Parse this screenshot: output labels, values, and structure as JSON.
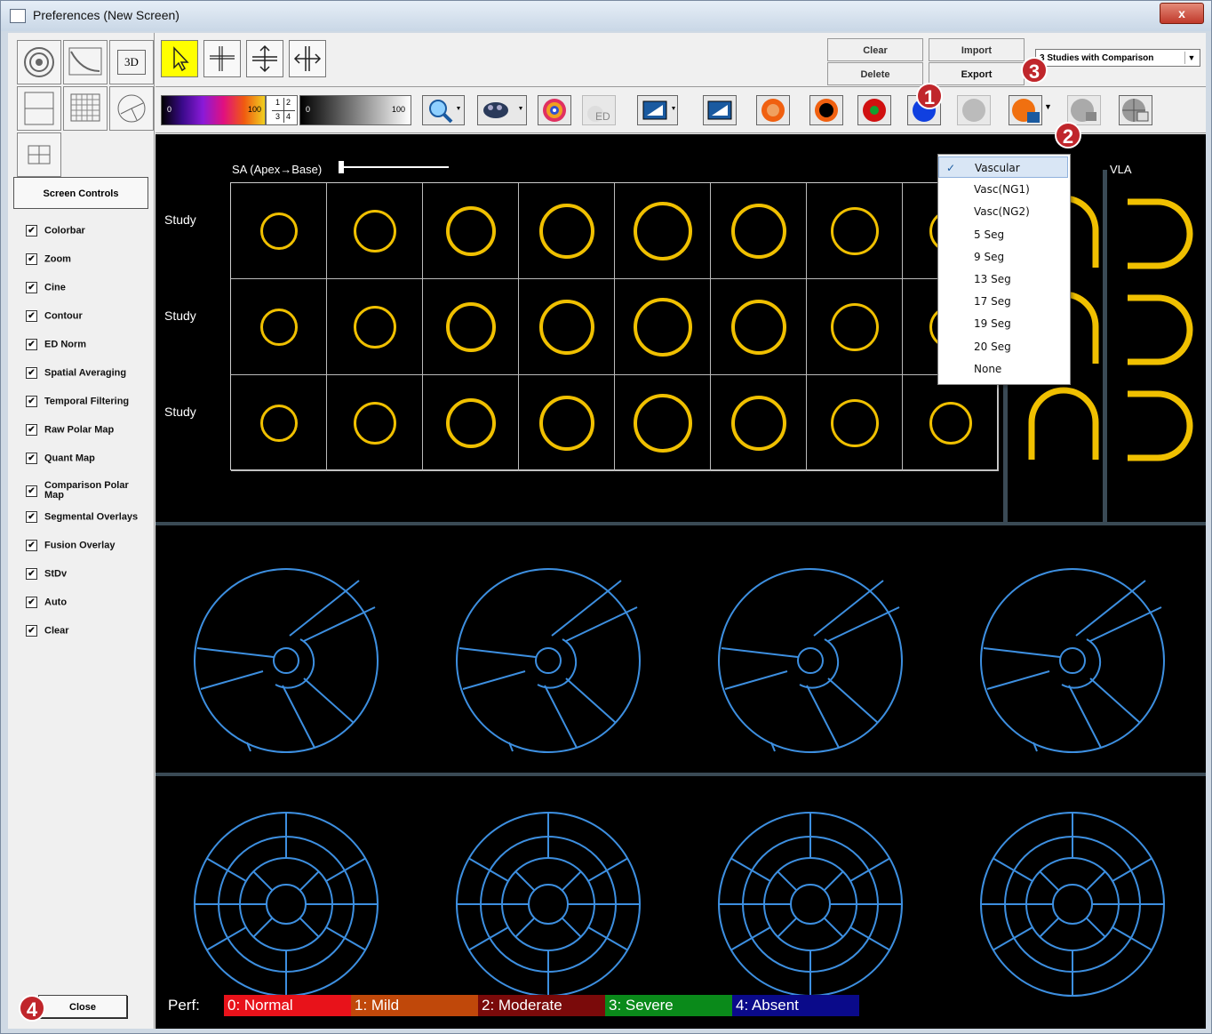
{
  "window": {
    "title": "Preferences (New Screen)",
    "close_glyph": "x"
  },
  "left_panel": {
    "layout_buttons": [
      "polar-map-layout",
      "curve-layout",
      "3d-layout",
      "split-layout",
      "grid-layout",
      "pie-layout",
      "tile-layout"
    ],
    "layout_3d_label": "3D",
    "screen_controls_label": "Screen Controls",
    "checkboxes": [
      {
        "label": "Colorbar",
        "checked": true
      },
      {
        "label": "Zoom",
        "checked": true
      },
      {
        "label": "Cine",
        "checked": true
      },
      {
        "label": "Contour",
        "checked": true
      },
      {
        "label": "ED Norm",
        "checked": true
      },
      {
        "label": "Spatial Averaging",
        "checked": true
      },
      {
        "label": "Temporal Filtering",
        "checked": true
      },
      {
        "label": "Raw Polar Map",
        "checked": true
      },
      {
        "label": "Quant Map",
        "checked": true
      },
      {
        "label": "Comparison Polar Map",
        "checked": true
      },
      {
        "label": "Segmental Overlays",
        "checked": true
      },
      {
        "label": "Fusion Overlay",
        "checked": true
      },
      {
        "label": "StDv",
        "checked": true
      },
      {
        "label": "Auto",
        "checked": true
      },
      {
        "label": "Clear",
        "checked": true
      }
    ],
    "close_label": "Close",
    "check_glyph": "✔"
  },
  "toolbar": {
    "clear_label": "Clear",
    "delete_label": "Delete",
    "import_label": "Import",
    "export_label": "Export",
    "study_select": "3 Studies with Comparison",
    "colorbar1": {
      "min": "0",
      "max": "100"
    },
    "colorbar2": {
      "min": "0",
      "max": "100"
    },
    "quad": [
      "1",
      "2",
      "3",
      "4"
    ],
    "ed_label": "ED"
  },
  "display": {
    "sa_label": "SA (Apex→Base)",
    "vla_label": "VLA",
    "row_labels": [
      "Study",
      "Study",
      "Study"
    ],
    "contour_color": "#f0c000",
    "polar_color": "#3d8fe0"
  },
  "dropdown": {
    "items": [
      "Vascular",
      "Vasc(NG1)",
      "Vasc(NG2)",
      "5 Seg",
      "9 Seg",
      "13 Seg",
      "17 Seg",
      "19 Seg",
      "20 Seg",
      "None"
    ],
    "selected": "Vascular",
    "check_glyph": "✓"
  },
  "perf_legend": {
    "label": "Perf:",
    "items": [
      {
        "label": "0: Normal",
        "color": "#e8121a"
      },
      {
        "label": "1: Mild",
        "color": "#c0480a"
      },
      {
        "label": "2: Moderate",
        "color": "#7a0a0a"
      },
      {
        "label": "3: Severe",
        "color": "#0a8a1a"
      },
      {
        "label": "4: Absent",
        "color": "#0a0a8a"
      }
    ]
  },
  "badges": [
    "1",
    "2",
    "3",
    "4"
  ]
}
